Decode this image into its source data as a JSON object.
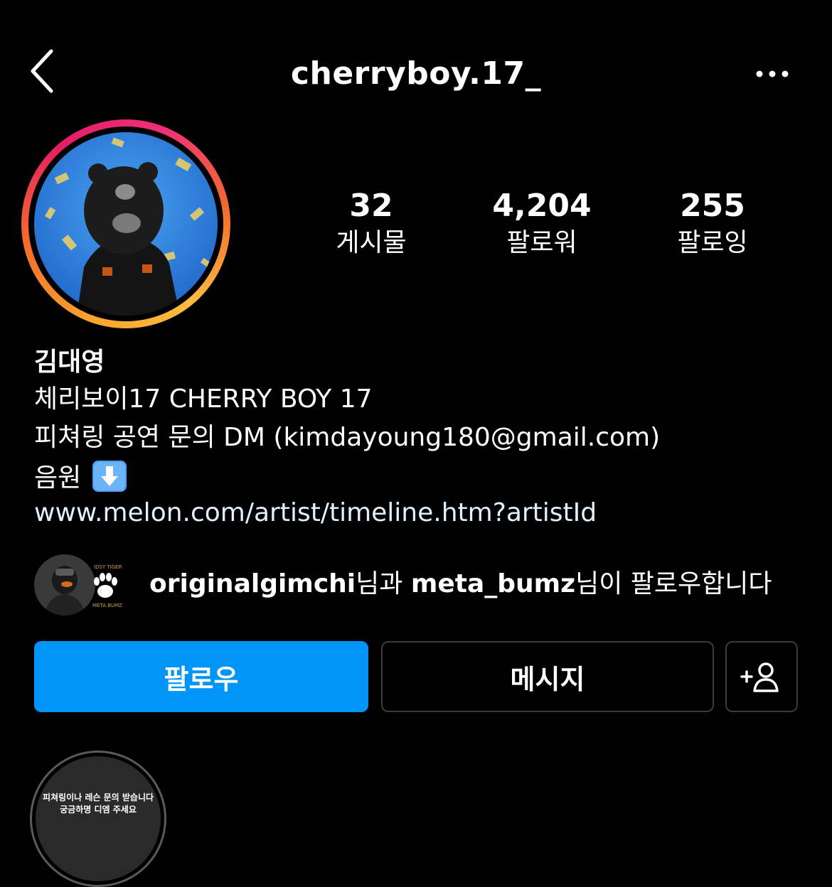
{
  "header": {
    "username": "cherryboy.17_",
    "back_icon": "chevron-left-icon",
    "more_icon": "more-horizontal-icon"
  },
  "profile": {
    "avatar_icon": "profile-picture",
    "story_ring_colors": [
      "#f9a52b",
      "#e61d63"
    ]
  },
  "stats": {
    "posts": {
      "value": "32",
      "label": "게시물"
    },
    "followers": {
      "value": "4,204",
      "label": "팔로워"
    },
    "following": {
      "value": "255",
      "label": "팔로잉"
    }
  },
  "bio": {
    "name": "김대영",
    "line1": "체리보이17 CHERRY BOY 17",
    "line2": "피쳐링 공연 문의 DM (kimdayoung180@gmail.com)",
    "line3": "음원",
    "line3_emoji": "down-arrow-emoji",
    "link": "www.melon.com/artist/timeline.htm?artistId"
  },
  "mutual": {
    "user1": "originalgimchi",
    "connector": "님과 ",
    "user2": "meta_bumz",
    "suffix": "님이 팔로우합니다"
  },
  "actions": {
    "follow_label": "팔로우",
    "message_label": "메시지",
    "suggest_icon": "add-person-icon",
    "follow_color": "#0095f6"
  },
  "highlight": {
    "line1": "피쳐링이나 레슨 문의 받습니다",
    "line2": "궁금하명 디엠 주세요"
  }
}
